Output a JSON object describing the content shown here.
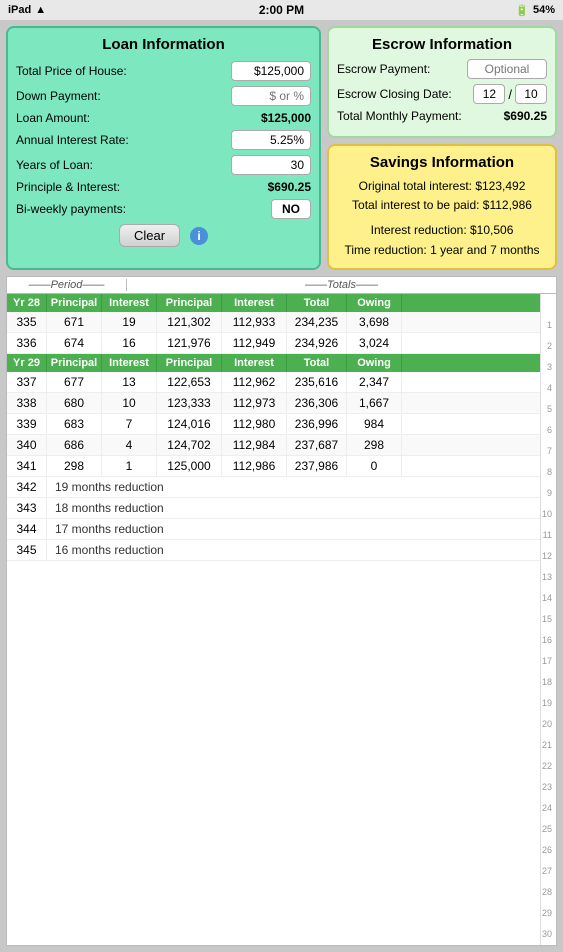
{
  "statusBar": {
    "carrier": "iPad",
    "time": "2:00 PM",
    "battery": "54%"
  },
  "loanPanel": {
    "title": "Loan Information",
    "rows": [
      {
        "label": "Total Price of House:",
        "value": "$125,000",
        "type": "input"
      },
      {
        "label": "Down Payment:",
        "value": "$ or %",
        "type": "input-placeholder"
      },
      {
        "label": "Loan Amount:",
        "value": "$125,000",
        "type": "static"
      },
      {
        "label": "Annual Interest Rate:",
        "value": "5.25%",
        "type": "input"
      },
      {
        "label": "Years of Loan:",
        "value": "30",
        "type": "input"
      },
      {
        "label": "Principle & Interest:",
        "value": "$690.25",
        "type": "static"
      },
      {
        "label": "Bi-weekly payments:",
        "value": "NO",
        "type": "button"
      }
    ],
    "clearButton": "Clear"
  },
  "escrowPanel": {
    "title": "Escrow Information",
    "rows": [
      {
        "label": "Escrow Payment:",
        "value": "Optional",
        "type": "optional"
      },
      {
        "label": "Escrow Closing Date:",
        "month": "12",
        "slash": "/",
        "day": "10",
        "type": "date"
      },
      {
        "label": "Total Monthly Payment:",
        "value": "$690.25",
        "type": "static"
      }
    ]
  },
  "savingsPanel": {
    "title": "Savings Information",
    "lines": [
      "Original total interest: $123,492",
      "Total interest to be paid: $112,986",
      "",
      "Interest reduction: $10,506",
      "Time reduction: 1 year and 7 months"
    ]
  },
  "tableHeaders": {
    "periodLabel": "Period",
    "totalsLabel": "Totals",
    "columns": [
      "Yr 28",
      "Principal",
      "Interest",
      "Principal",
      "Interest",
      "Total",
      "Owing"
    ]
  },
  "yearHeaders": [
    {
      "year": "Yr 28",
      "cols": [
        "Principal",
        "Interest",
        "Principal",
        "Interest",
        "Total",
        "Owing"
      ]
    },
    {
      "year": "Yr 29",
      "cols": [
        "Principal",
        "Interest",
        "Principal",
        "Interest",
        "Total",
        "Owing"
      ]
    }
  ],
  "tableRows": [
    {
      "type": "data",
      "num": "335",
      "principal": "671",
      "interest": "19",
      "totPrincipal": "121,302",
      "totInterest": "112,933",
      "total": "234,235",
      "owing": "3,698",
      "rowNums": [
        1,
        2,
        3,
        4
      ]
    },
    {
      "type": "data",
      "num": "336",
      "principal": "674",
      "interest": "16",
      "totPrincipal": "121,976",
      "totInterest": "112,949",
      "total": "234,926",
      "owing": "3,024",
      "rowNums": [
        5,
        6
      ]
    },
    {
      "type": "yearheader",
      "year": "Yr 29",
      "rowNums": [
        7
      ]
    },
    {
      "type": "data",
      "num": "337",
      "principal": "677",
      "interest": "13",
      "totPrincipal": "122,653",
      "totInterest": "112,962",
      "total": "235,616",
      "owing": "2,347",
      "rowNums": [
        8,
        9,
        10
      ]
    },
    {
      "type": "data",
      "num": "338",
      "principal": "680",
      "interest": "10",
      "totPrincipal": "123,333",
      "totInterest": "112,973",
      "total": "236,306",
      "owing": "1,667",
      "rowNums": [
        11,
        12
      ]
    },
    {
      "type": "data",
      "num": "339",
      "principal": "683",
      "interest": "7",
      "totPrincipal": "124,016",
      "totInterest": "112,980",
      "total": "236,996",
      "owing": "984",
      "rowNums": [
        13,
        14
      ]
    },
    {
      "type": "data",
      "num": "340",
      "principal": "686",
      "interest": "4",
      "totPrincipal": "124,702",
      "totInterest": "112,984",
      "total": "237,687",
      "owing": "298",
      "rowNums": [
        15,
        16,
        17
      ]
    },
    {
      "type": "data",
      "num": "341",
      "principal": "298",
      "interest": "1",
      "totPrincipal": "125,000",
      "totInterest": "112,986",
      "total": "237,986",
      "owing": "0",
      "rowNums": [
        18,
        19,
        20
      ]
    },
    {
      "type": "reduction",
      "num": "342",
      "text": "19 months reduction",
      "rowNums": [
        21,
        22
      ]
    },
    {
      "type": "reduction",
      "num": "343",
      "text": "18 months reduction",
      "rowNums": [
        23,
        24
      ]
    },
    {
      "type": "reduction",
      "num": "344",
      "text": "17 months reduction",
      "rowNums": [
        25,
        26,
        27
      ]
    },
    {
      "type": "reduction",
      "num": "345",
      "text": "16 months reduction",
      "rowNums": [
        28,
        29,
        30
      ]
    }
  ]
}
